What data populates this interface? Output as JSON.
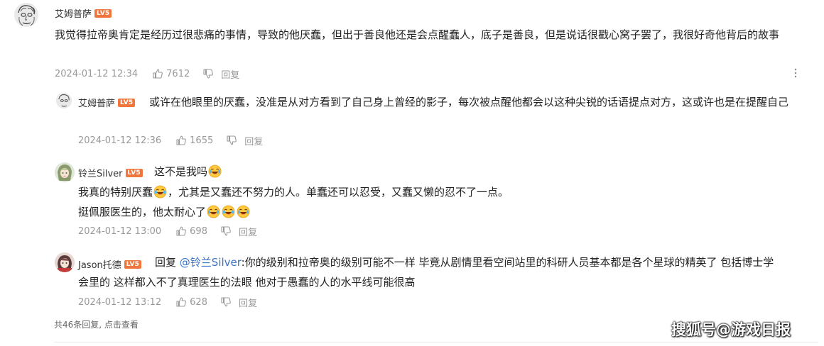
{
  "comments": [
    {
      "user": "艾姆普萨",
      "level_badge": "LV5",
      "text": "我觉得拉帝奥肯定是经历过很悲痛的事情，导致的他厌蠢，但出于善良他还是会点醒蠢人，底子是善良，但是说话很戳心窝子罢了，我很好奇他背后的故事",
      "time": "2024-01-12 12:34",
      "likes": "7612",
      "reply_label": "回复",
      "more_icon": "more-vertical-icon"
    }
  ],
  "replies": [
    {
      "user": "艾姆普萨",
      "level_badge": "LV5",
      "text": "或许在他眼里的厌蠢，没准是从对方看到了自己身上曾经的影子，每次被点醒他都会以这种尖锐的话语提点对方，这或许也是在提醒自己",
      "time": "2024-01-12 12:36",
      "likes": "1655",
      "reply_label": "回复"
    },
    {
      "user": "铃兰Silver",
      "level_badge": "LV5",
      "line1": "这不是我吗",
      "line2a": "我真的特别厌蠢",
      "line2b": "，尤其是又蠢还不努力的人。单蠢还可以忍受，又蠢又懒的忍不了一点。",
      "line3": "挺佩服医生的，他太耐心了",
      "emoji": "laugh-cry-emoji",
      "time": "2024-01-12 13:00",
      "likes": "698",
      "reply_label": "回复"
    },
    {
      "user": "Jason托德",
      "level_badge": "LV5",
      "reply_prefix": "回复",
      "mention": "@铃兰Silver",
      "text_line1": ":你的级别和拉帝奥的级别可能不一样 毕竟从剧情里看空间站里的科研人员基本都是各个星球的精英了 包括博士学",
      "text_line2": "会里的 这样都入不了真理医生的法眼 他对于愚蠢的人的水平线可能很高",
      "time": "2024-01-12 13:12",
      "likes": "628",
      "reply_label": "回复"
    }
  ],
  "footer": {
    "summary": "共46条回复, 点击查看"
  },
  "watermark": "搜狐号@游戏日报",
  "colors": {
    "level_badge": "#f0763d",
    "mention": "#3b73c8",
    "meta_text": "#999999"
  }
}
